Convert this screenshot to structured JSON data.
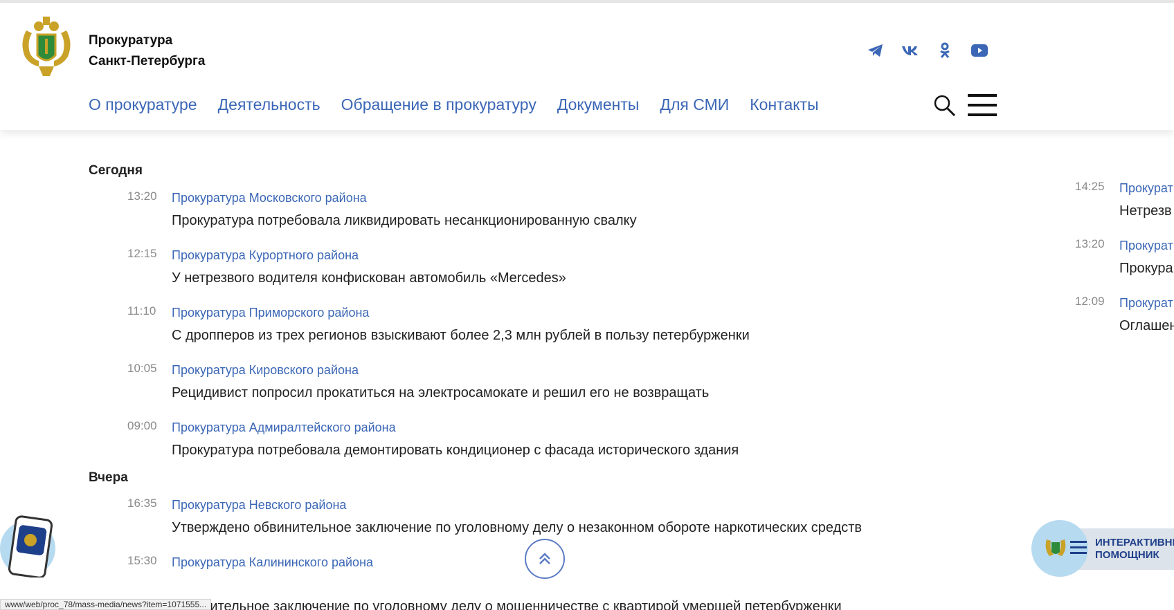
{
  "header": {
    "title_line1": "Прокуратура",
    "title_line2": "Санкт-Петербурга"
  },
  "social": [
    {
      "icon": "telegram-icon"
    },
    {
      "icon": "vk-icon"
    },
    {
      "icon": "odnoklassniki-icon"
    },
    {
      "icon": "youtube-icon"
    }
  ],
  "nav": [
    "О прокуратуре",
    "Деятельность",
    "Обращение в прокуратуру",
    "Документы",
    "Для СМИ",
    "Контакты"
  ],
  "feed": {
    "today_label": "Сегодня",
    "today": [
      {
        "time": "13:20",
        "source": "Прокуратура Московского района",
        "title": "Прокуратура потребовала ликвидировать несанкционированную свалку"
      },
      {
        "time": "12:15",
        "source": "Прокуратура Курортного района",
        "title": "У нетрезвого водителя конфискован автомобиль «Mercedes»"
      },
      {
        "time": "11:10",
        "source": "Прокуратура Приморского района",
        "title": "С дропперов из трех регионов взыскивают более 2,3 млн рублей в пользу петербурженки"
      },
      {
        "time": "10:05",
        "source": "Прокуратура Кировского района",
        "title": "Рецидивист попросил прокатиться на электросамокате и решил его не возвращать"
      },
      {
        "time": "09:00",
        "source": "Прокуратура Адмиралтейского района",
        "title": "Прокуратура потребовала демонтировать кондиционер с фасада исторического здания"
      }
    ],
    "yesterday_label": "Вчера",
    "yesterday": [
      {
        "time": "16:35",
        "source": "Прокуратура Невского района",
        "title": "Утверждено обвинительное заключение по уголовному делу о незаконном обороте наркотических средств"
      },
      {
        "time": "15:30",
        "source": "Прокуратура Калининского района",
        "title": ""
      }
    ],
    "cut_text": "обвинительное заключение по уголовному делу о мошенничестве с квартирой умершей петербурженки"
  },
  "side_feed": [
    {
      "time": "14:25",
      "source": "Прокурат",
      "title": "Нетрезв"
    },
    {
      "time": "13:20",
      "source": "Прокурат",
      "title": "Прокура"
    },
    {
      "time": "12:09",
      "source": "Прокурат",
      "title": "Оглашен"
    }
  ],
  "assistant": {
    "line1": "ИНТЕРАКТИВНЫ",
    "line2": "ПОМОЩНИК"
  },
  "status_url": "www/web/proc_78/mass-media/news?item=1071555..."
}
